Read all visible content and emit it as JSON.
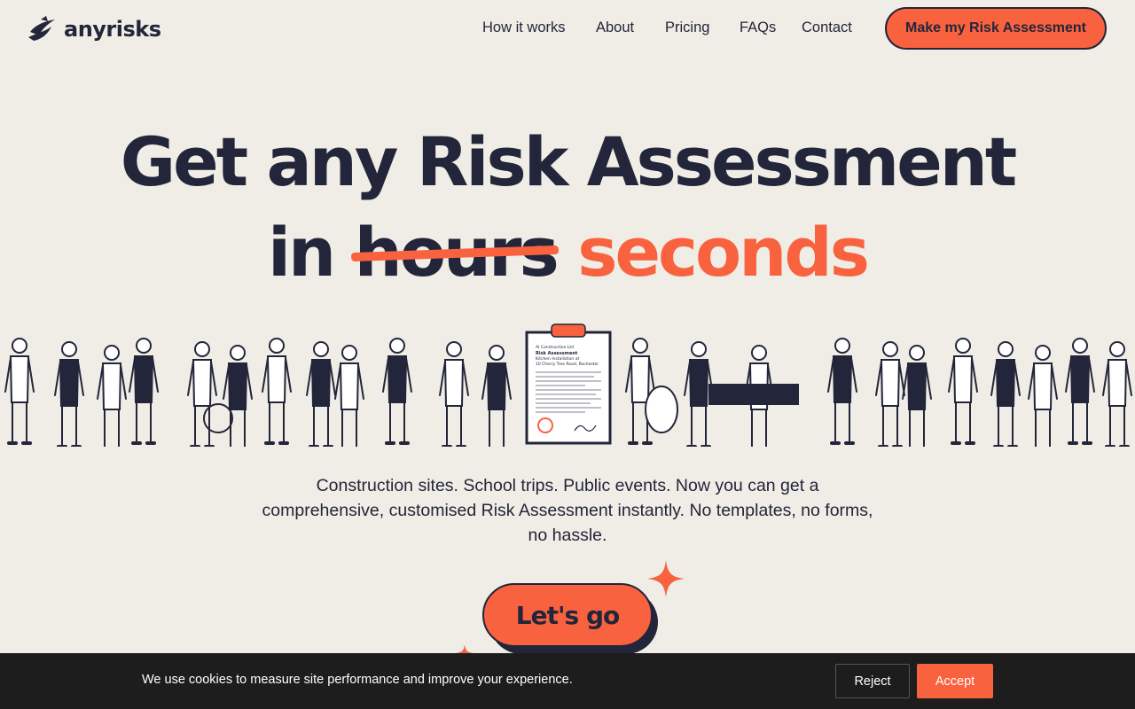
{
  "header": {
    "logo_text": "anyrisks",
    "logo_icon": "swoosh-logo-icon",
    "nav": [
      {
        "label": "How it works"
      },
      {
        "label": "About"
      },
      {
        "label": "Pricing"
      },
      {
        "label": "FAQs"
      },
      {
        "label": "Contact"
      }
    ],
    "cta_label": "Make my Risk Assessment"
  },
  "hero": {
    "line1": "Get any Risk Assessment",
    "line2_prefix": "in",
    "line2_struck": "hours",
    "line2_accent": "seconds",
    "description": "Construction sites. School trips. Public events. Now you can get a comprehensive, customised Risk Assessment instantly. No templates, no forms, no hassle.",
    "go_label": "Let's go",
    "clipboard": {
      "line1": "Risk Assessment",
      "line2": "Kitchen Installation at",
      "line3": "10 Cherry Tree Road, Rochester"
    }
  },
  "cookie_bar": {
    "text": "We use cookies to measure site performance and improve your experience.",
    "reject_label": "Reject",
    "accept_label": "Accept"
  },
  "colors": {
    "background": "#efede5",
    "ink": "#23253a",
    "accent": "#f9623f",
    "cookie_bg": "#1d1d1d"
  }
}
